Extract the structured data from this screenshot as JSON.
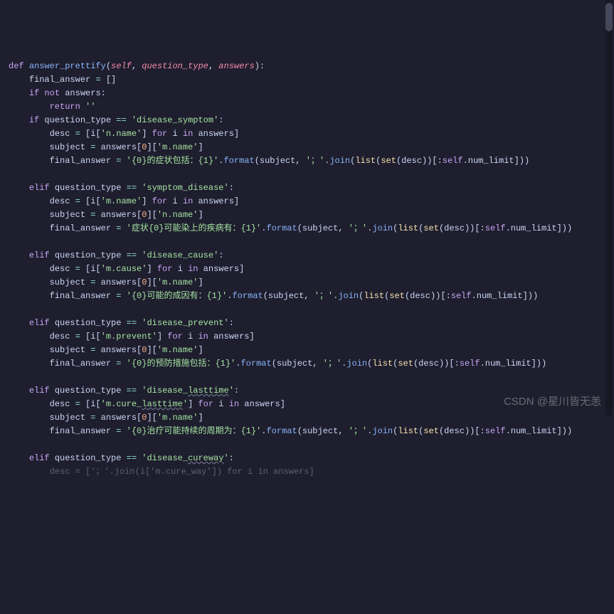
{
  "code": {
    "def_kw": "def",
    "func_name": "answer_prettify",
    "sig_open": "(",
    "self_kw": "self",
    "comma": ", ",
    "param1": "question_type",
    "param2": "answers",
    "sig_close": "):",
    "l2_a": "final_answer ",
    "eq": "=",
    "l2_b": " []",
    "if_kw": "if",
    "not_kw": "not",
    "l3_b": " answers:",
    "return_kw": "return",
    "l4_b": " ",
    "empty_str": "''",
    "l5_b": " question_type ",
    "eqeq": "==",
    "l5_d": " ",
    "str_ds": "'disease_symptom'",
    "colon": ":",
    "l6_a": "desc ",
    "l6_c": " [i[",
    "str_nname": "'n.name'",
    "l6_e": "] ",
    "for_kw": "for",
    "l6_g": " i ",
    "in_kw": "in",
    "l6_i": " answers]",
    "l7_a": "subject ",
    "l7_c": " answers[",
    "zero": "0",
    "l7_e": "][",
    "str_mname": "'m.name'",
    "l7_g": "]",
    "l8_a": "final_answer ",
    "l8_c": " ",
    "str_ds_fmt": "'{0}的症状包括：{1}'",
    "dot": ".",
    "format_fn": "format",
    "l8_f": "(subject, ",
    "str_semi": "'；'",
    "join_fn": "join",
    "l8_i": "(",
    "list_bi": "list",
    "l8_k": "(",
    "set_bi": "set",
    "l8_m": "(desc))[:",
    "l8_o": ".num_limit]))",
    "elif_kw": "elif",
    "str_sd": "'symptom_disease'",
    "str_sd_fmt": "'症状{0}可能染上的疾病有：{1}'",
    "str_dc": "'disease_cause'",
    "str_mcause": "'m.cause'",
    "str_dc_fmt": "'{0}可能的成因有：{1}'",
    "str_dp": "'disease_prevent'",
    "str_mprevent": "'m.prevent'",
    "str_dp_fmt": "'{0}的预防措施包括：{1}'",
    "str_dl_a": "'disease_",
    "str_dl_b": "lasttime",
    "str_dl_c": "'",
    "str_mcurelt_a": "'m.cure_",
    "str_mcurelt_b": "lasttime",
    "str_mcurelt_c": "'",
    "str_dl_fmt": "'{0}治疗可能持续的周期为：{1}'",
    "str_dcw_a": "'disease_",
    "str_dcw_b": "cureway",
    "str_dcw_c": "'",
    "l_last": "desc = ['；'.join(i['m.cure_way']) for i in answers]"
  },
  "watermark": "CSDN @星川皆无恙"
}
